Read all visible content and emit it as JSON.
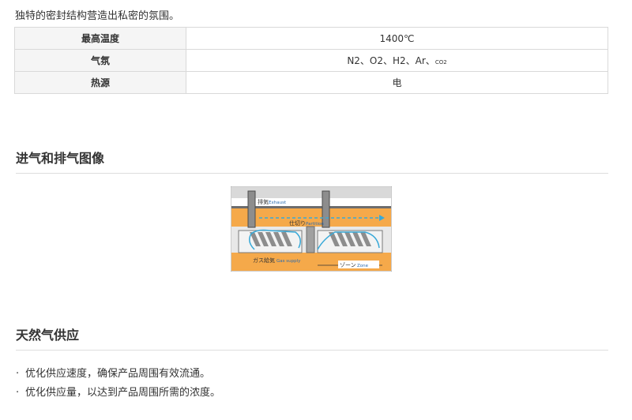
{
  "intro": "独特的密封结构营造出私密的氛围。",
  "spec": {
    "rows": [
      {
        "label": "最高温度",
        "value": "1400℃"
      },
      {
        "label": "气氛",
        "value": "N2、O2、H2、Ar、",
        "value_small": "CO2"
      },
      {
        "label": "热源",
        "value": "电"
      }
    ]
  },
  "section1": {
    "title": "进气和排气图像",
    "figure": {
      "exhaust_label": "排気",
      "exhaust_label_en": "Exhaust",
      "partition_label": "仕切り",
      "partition_label_en": "Partition",
      "gas_label": "ガス給気",
      "gas_label_en": "Gas supply",
      "zone_label": "ゾーン",
      "zone_label_en": "Zone",
      "colors": {
        "orange": "#f5a94a",
        "gray": "#8d8d8d",
        "dark": "#4a4a4a",
        "flow": "#39a9d8",
        "bg": "#ffffff"
      }
    }
  },
  "section2": {
    "title": "天然气供应",
    "bullets": [
      "优化供应速度，确保产品周围有效流通。",
      "优化供应量，以达到产品周围所需的浓度。"
    ]
  }
}
